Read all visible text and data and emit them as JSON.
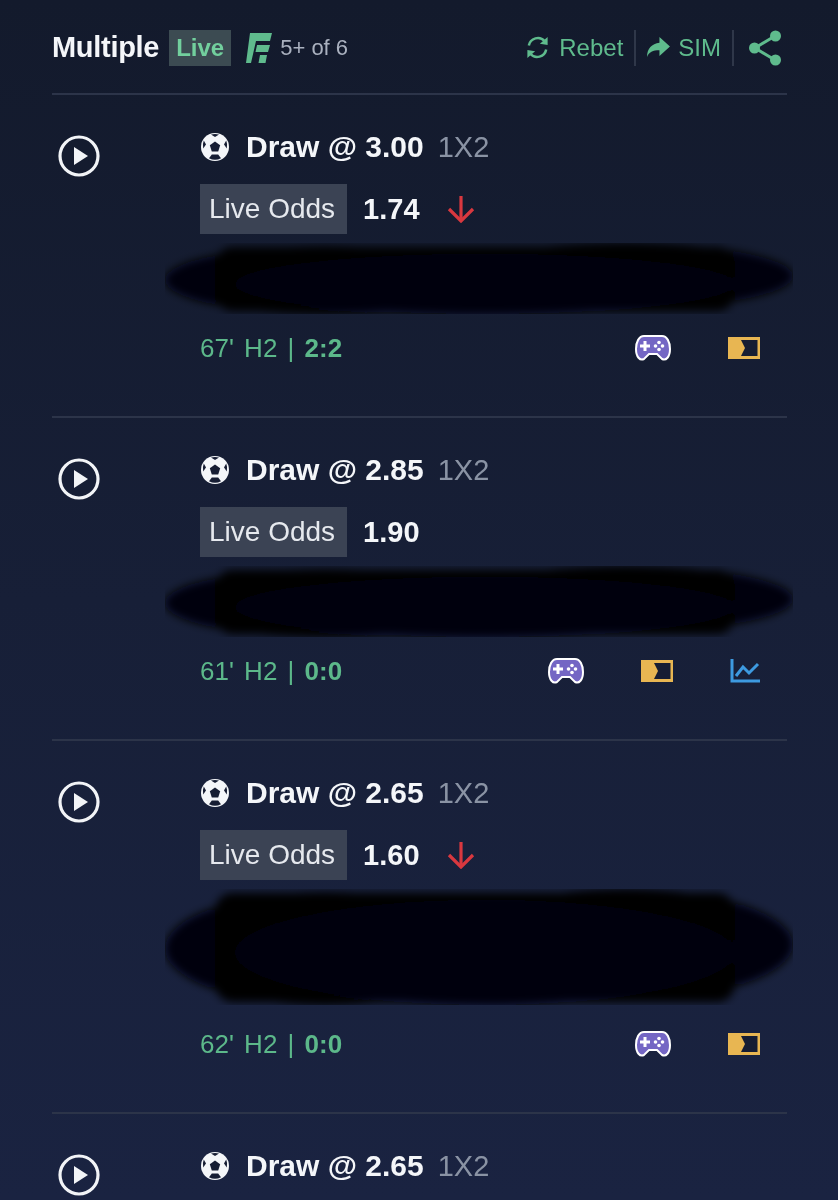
{
  "header": {
    "title": "Multiple",
    "badge": "Live",
    "legs_summary": "5+ of 6",
    "actions": [
      {
        "kind": "rebet",
        "label": "Rebet"
      },
      {
        "kind": "sim",
        "label": "SIM"
      },
      {
        "kind": "share"
      }
    ]
  },
  "bets": [
    {
      "selection": "Draw @ 3.00",
      "market": "1X2",
      "odds_label": "Live Odds",
      "live_odds": "1.74",
      "odds_falling": true,
      "match_redacted": true,
      "match_wraps": false,
      "status": "67' H2 | **2:2**",
      "icons": [
        {
          "kind": "gamepad"
        },
        {
          "kind": "banner"
        }
      ]
    },
    {
      "selection": "Draw @ 2.85",
      "market": "1X2",
      "odds_label": "Live Odds",
      "live_odds": "1.90",
      "odds_falling": false,
      "match_redacted": true,
      "match_wraps": false,
      "status": "61' H2 | **0:0**",
      "icons": [
        {
          "kind": "gamepad"
        },
        {
          "kind": "banner"
        },
        {
          "kind": "chart"
        }
      ]
    },
    {
      "selection": "Draw @ 2.65",
      "market": "1X2",
      "odds_label": "Live Odds",
      "live_odds": "1.60",
      "odds_falling": true,
      "match_redacted": true,
      "match_wraps": true,
      "status": "62' H2 | **0:0**",
      "icons": [
        {
          "kind": "gamepad"
        },
        {
          "kind": "banner"
        }
      ]
    },
    {
      "selection": "Draw @ 2.65",
      "market": "1X2"
    }
  ]
}
